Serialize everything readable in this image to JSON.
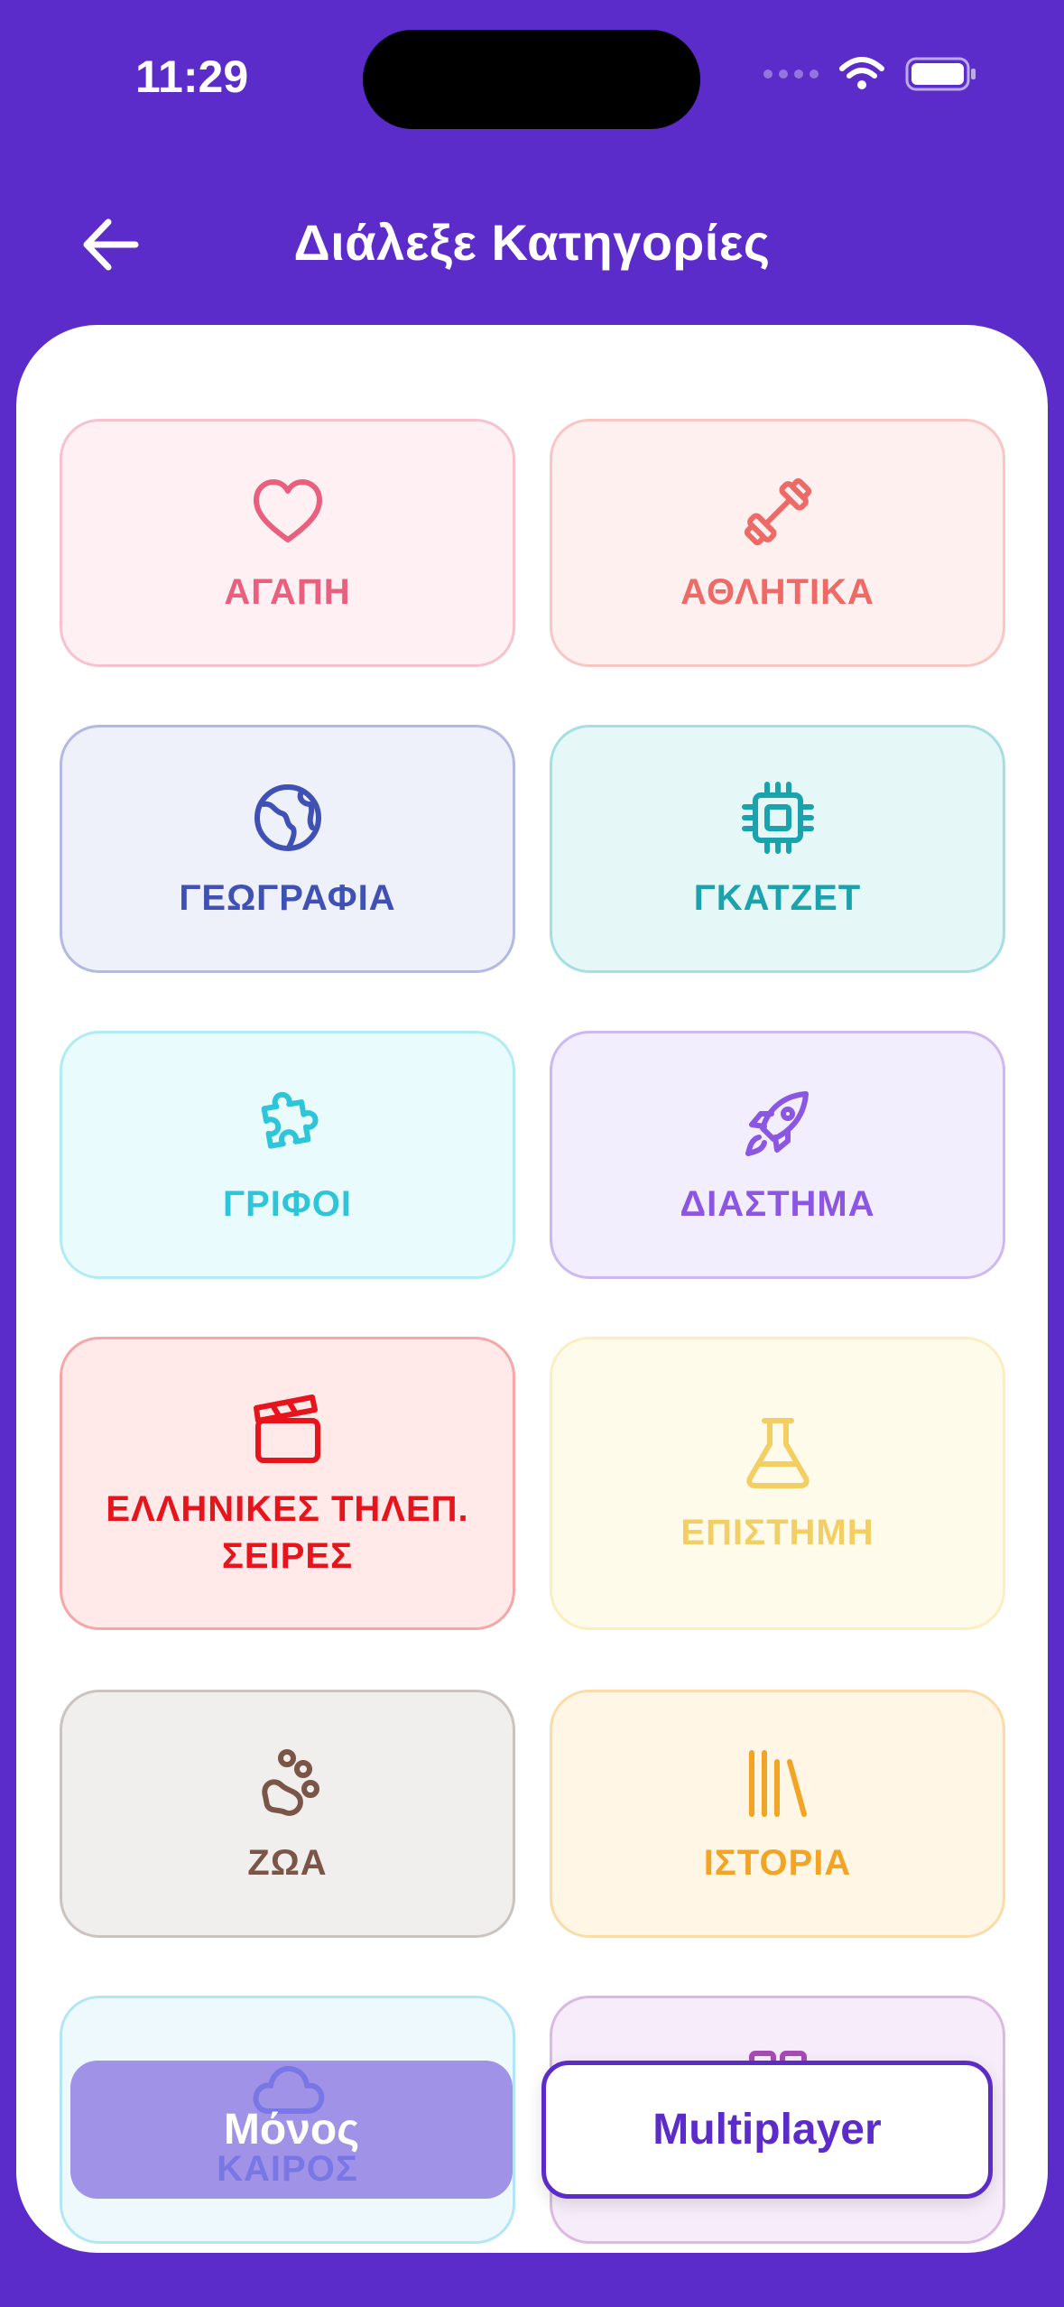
{
  "status": {
    "time": "11:29"
  },
  "header": {
    "title": "Διάλεξε Κατηγορίες"
  },
  "categories": [
    {
      "label": "ΑΓΑΠΗ",
      "icon": "heart-icon",
      "color": "#e8607e",
      "bg": "#fff0f3",
      "border": "#f6c2ce"
    },
    {
      "label": "ΑΘΛΗΤΙΚΑ",
      "icon": "dumbbell-icon",
      "color": "#ee6a66",
      "bg": "#fff0f0",
      "border": "#f8c7c4"
    },
    {
      "label": "ΓΕΩΓΡΑΦΙΑ",
      "icon": "globe-icon",
      "color": "#3f51b5",
      "bg": "#eef0fa",
      "border": "#b4b9e2"
    },
    {
      "label": "ΓΚΑΤΖΕΤ",
      "icon": "chip-icon",
      "color": "#1aa3ad",
      "bg": "#e6f7f8",
      "border": "#a5dfe4"
    },
    {
      "label": "ΓΡΙΦΟΙ",
      "icon": "puzzle-icon",
      "color": "#2fc5d8",
      "bg": "#eafbfd",
      "border": "#b0ecf3"
    },
    {
      "label": "ΔΙΑΣΤΗΜΑ",
      "icon": "rocket-icon",
      "color": "#8a56e2",
      "bg": "#f3eefd",
      "border": "#cdb9f2"
    },
    {
      "label": "ΕΛΛΗΝΙΚΕΣ ΤΗΛΕΠ. ΣΕΙΡΕΣ",
      "icon": "clapperboard-icon",
      "color": "#e8141b",
      "bg": "#ffe9e9",
      "border": "#f3a7a8"
    },
    {
      "label": "ΕΠΙΣΤΗΜΗ",
      "icon": "flask-icon",
      "color": "#f2ce63",
      "bg": "#fffbea",
      "border": "#fbeec2"
    },
    {
      "label": "ΖΩΑ",
      "icon": "paw-icon",
      "color": "#7a5548",
      "bg": "#f1efed",
      "border": "#cbc3bf"
    },
    {
      "label": "ΙΣΤΟΡΙΑ",
      "icon": "books-icon",
      "color": "#f2a424",
      "bg": "#fff6e6",
      "border": "#f9dcaa"
    },
    {
      "label": "ΚΑΙΡΟΣ",
      "icon": "cloud-icon",
      "color": "#3b82f6",
      "bg": "#eef9fd",
      "border": "#b3e6f4"
    },
    {
      "label": "",
      "icon": "category-icon",
      "color": "#a64bb5",
      "bg": "#f7ecf9",
      "border": "#ddb8e4"
    }
  ],
  "buttons": {
    "solo": "Μόνος",
    "multiplayer": "Multiplayer"
  }
}
